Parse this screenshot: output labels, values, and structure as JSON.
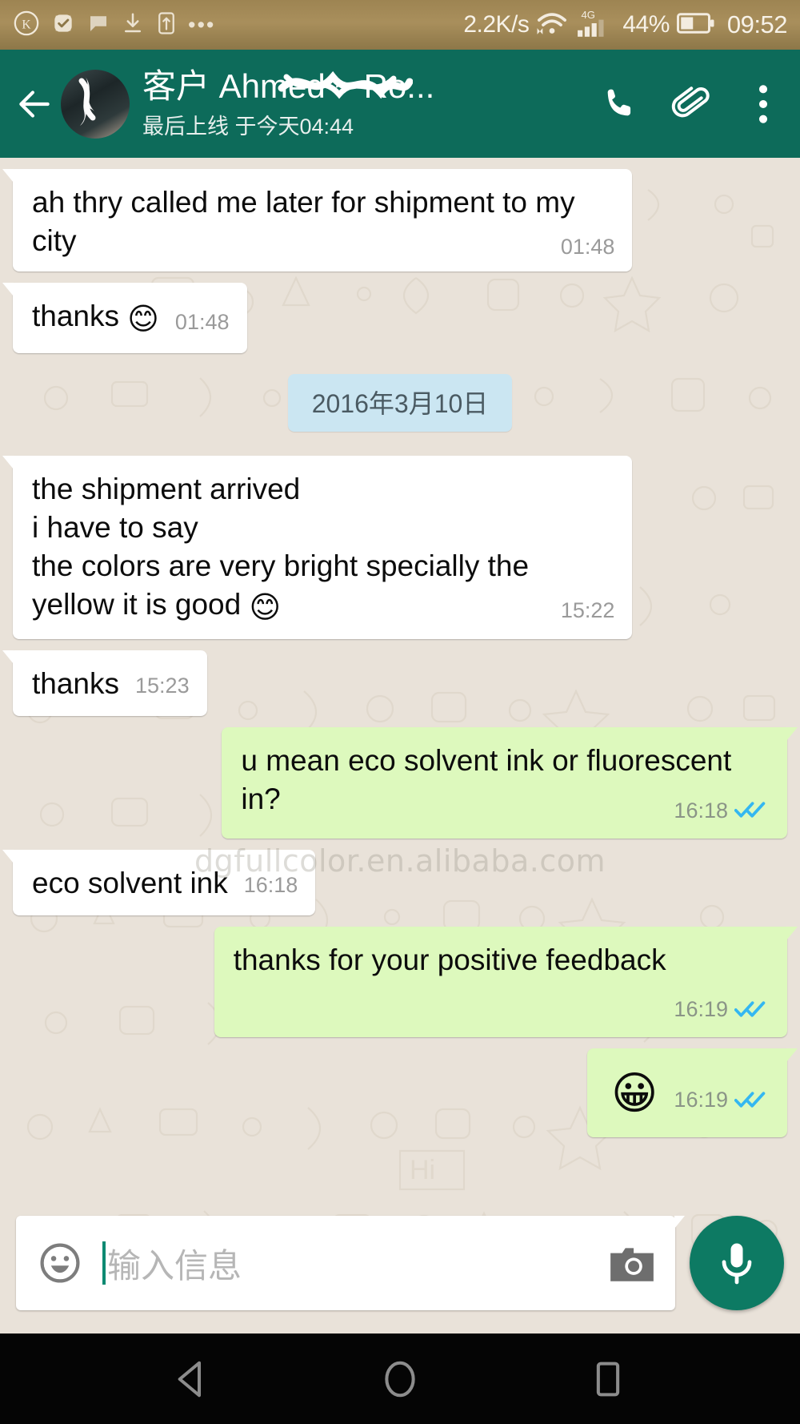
{
  "status_bar": {
    "left_icons": [
      "kiwi-k-icon",
      "check-badge-icon",
      "chat-bubble-icon",
      "download-icon",
      "sim-card-icon",
      "more-dots-icon"
    ],
    "network_speed": "2.2K/s",
    "wifi_icon": "wifi-icon",
    "network_type": "4G",
    "signal_icon": "signal-bars-icon",
    "battery_percent": "44%",
    "battery_icon": "battery-icon",
    "time": "09:52"
  },
  "header": {
    "back_icon": "back-arrow-icon",
    "avatar": "contact-avatar",
    "contact_name": "客户 Ahmed ~ Ro...",
    "contact_status": "最后上线 于今天04:44",
    "call_icon": "phone-icon",
    "attach_icon": "paperclip-icon",
    "menu_icon": "more-vertical-icon",
    "accent_color": "#0d6b5a"
  },
  "chat": {
    "watermark": "dgfullcolor.en.alibaba.com",
    "date_divider": "2016年3月10日",
    "incoming_bubble_color": "#ffffff",
    "outgoing_bubble_color": "#ddf9bd",
    "read_tick_color": "#34b7f1",
    "messages": [
      {
        "id": "m1",
        "direction": "in",
        "text": "ah thry called me later for shipment to my city",
        "emoji": "",
        "time": "01:48",
        "status": "",
        "layout": "wrap"
      },
      {
        "id": "m2",
        "direction": "in",
        "text": "thanks ",
        "emoji": "😊",
        "time": "01:48",
        "status": "",
        "layout": "inline"
      },
      {
        "id": "m3",
        "direction": "in",
        "text": "the shipment arrived\ni have to say\nthe colors are very bright specially the yellow it is good ",
        "emoji": "😊",
        "time": "15:22",
        "status": "",
        "layout": "wrap"
      },
      {
        "id": "m4",
        "direction": "in",
        "text": "thanks",
        "emoji": "",
        "time": "15:23",
        "status": "",
        "layout": "inline"
      },
      {
        "id": "m5",
        "direction": "out",
        "text": "u mean eco solvent ink or fluorescent in?",
        "emoji": "",
        "time": "16:18",
        "status": "read",
        "layout": "wrap"
      },
      {
        "id": "m6",
        "direction": "in",
        "text": "eco solvent ink",
        "emoji": "",
        "time": "16:18",
        "status": "",
        "layout": "inline"
      },
      {
        "id": "m7",
        "direction": "out",
        "text": "thanks for your positive feedback",
        "emoji": "",
        "time": "16:19",
        "status": "read",
        "layout": "wrap"
      },
      {
        "id": "m8",
        "direction": "out",
        "text": "",
        "emoji": "😀",
        "time": "16:19",
        "status": "read",
        "layout": "inline"
      }
    ]
  },
  "input_bar": {
    "emoji_icon": "smiley-face-icon",
    "placeholder": "输入信息",
    "camera_icon": "camera-icon",
    "mic_icon": "microphone-icon",
    "mic_button_color": "#0d7a63"
  },
  "nav_bar": {
    "back_icon": "nav-back-triangle-icon",
    "home_icon": "nav-home-circle-icon",
    "recents_icon": "nav-recents-square-icon"
  }
}
